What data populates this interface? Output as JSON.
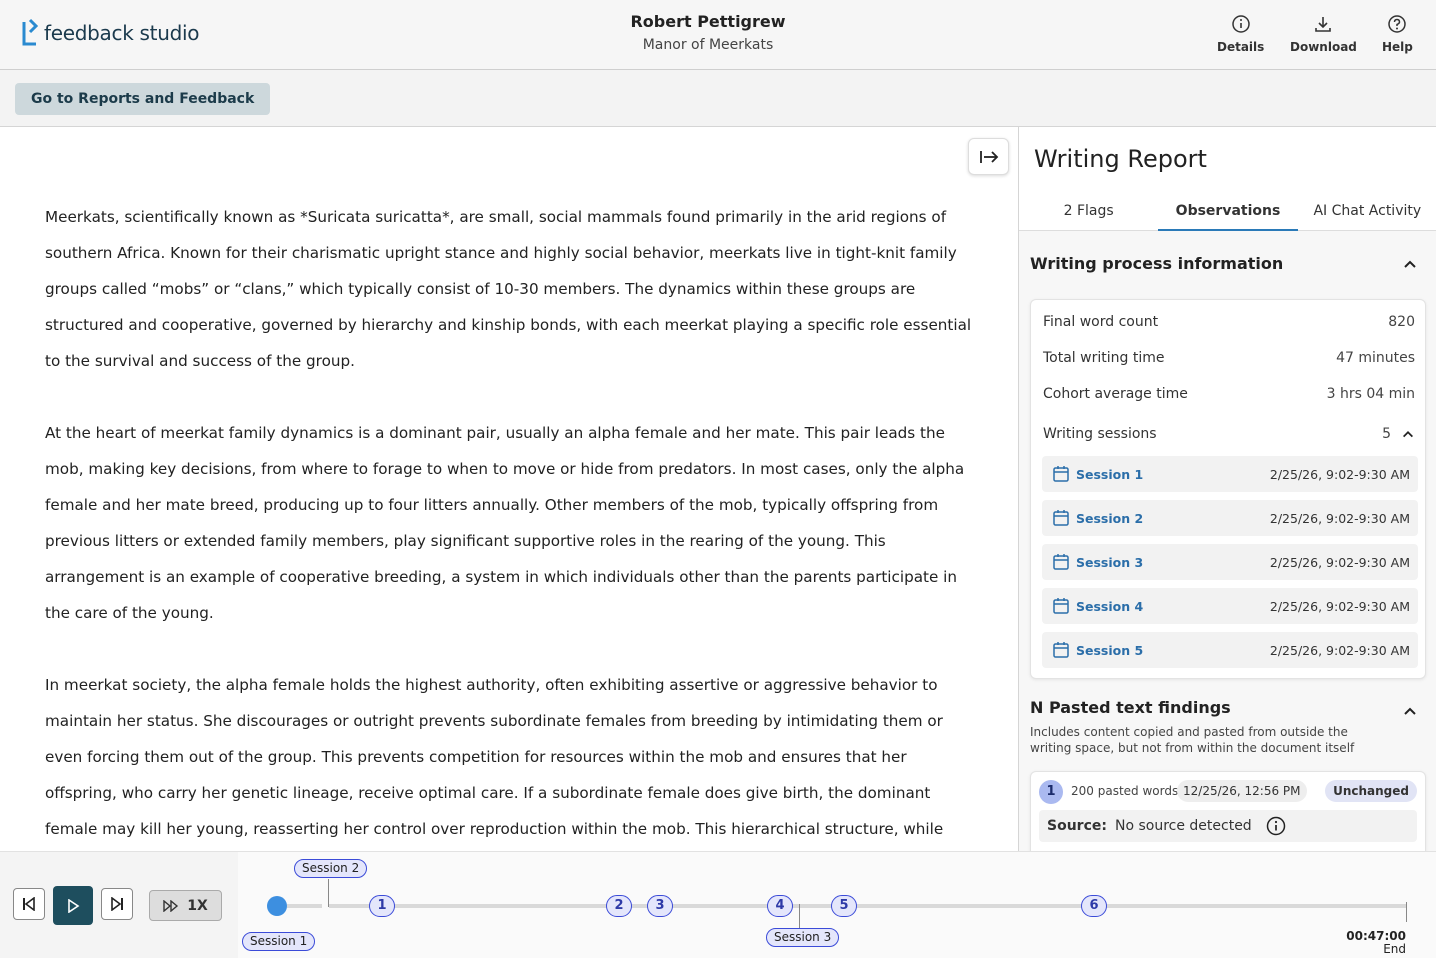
{
  "app": {
    "logo_text": "feedback studio"
  },
  "header": {
    "student_name": "Robert Pettigrew",
    "assignment_title": "Manor of Meerkats",
    "buttons": {
      "details": "Details",
      "download": "Download",
      "help": "Help"
    }
  },
  "subbar": {
    "back_label": "Go to Reports and Feedback"
  },
  "document": {
    "paragraphs": [
      "Meerkats, scientifically known as *Suricata suricatta*, are small, social mammals found primarily in the arid regions of southern Africa. Known for their charismatic upright stance and highly social behavior, meerkats live in tight-knit family groups called “mobs” or “clans,” which typically consist of 10-30 members. The dynamics within these groups are structured and cooperative, governed by hierarchy and kinship bonds, with each meerkat playing a specific role essential to the survival and success of the group.",
      "At the heart of meerkat family dynamics is a dominant pair, usually an alpha female and her mate. This pair leads the mob, making key decisions, from where to forage to when to move or hide from predators. In most cases, only the alpha female and her mate breed, producing up to four litters annually. Other members of the mob, typically offspring from previous litters or extended family members, play significant supportive roles in the rearing of the young. This arrangement is an example of cooperative breeding, a system in which individuals other than the parents participate in the care of the young.",
      "In meerkat society, the alpha female holds the highest authority, often exhibiting assertive or aggressive behavior to maintain her status. She discourages or outright prevents subordinate females from breeding by intimidating them or even forcing them out of the group. This prevents competition for resources within the mob and ensures that her offspring, who carry her genetic lineage, receive optimal care. If a subordinate female does give birth, the dominant female may kill her young, reasserting her control over reproduction within the mob. This hierarchical structure, while seemingly harsh, increases the likelihood that the dominant pair’s offspring will survive, helping to stabilize the group."
    ]
  },
  "panel": {
    "title": "Writing Report",
    "tabs": [
      "2 Flags",
      "Observations",
      "AI Chat Activity"
    ],
    "active_tab": "Observations",
    "writing_process": {
      "heading": "Writing process information",
      "rows": [
        {
          "label": "Final word count",
          "value": "820"
        },
        {
          "label": "Total writing time",
          "value": "47 minutes"
        },
        {
          "label": "Cohort average time",
          "value": "3 hrs 04 min"
        }
      ],
      "sessions_label": "Writing sessions",
      "sessions_count": "5",
      "sessions": [
        {
          "name": "Session 1",
          "date": "2/25/26, 9:02-9:30 AM"
        },
        {
          "name": "Session 2",
          "date": "2/25/26, 9:02-9:30 AM"
        },
        {
          "name": "Session 3",
          "date": "2/25/26, 9:02-9:30 AM"
        },
        {
          "name": "Session 4",
          "date": "2/25/26, 9:02-9:30 AM"
        },
        {
          "name": "Session 5",
          "date": "2/25/26, 9:02-9:30 AM"
        }
      ]
    },
    "pasted": {
      "heading": "N Pasted text findings",
      "description": "Includes content copied and pasted from outside the writing space, but not from within the document itself",
      "items": [
        {
          "number": "1",
          "words": "200 pasted words",
          "date": "12/25/26, 12:56 PM",
          "status": "Unchanged",
          "source_label": "Source:",
          "source_value": "No source detected"
        }
      ]
    }
  },
  "playback": {
    "speed": "1X",
    "markers": [
      "1",
      "2",
      "3",
      "4",
      "5",
      "6"
    ],
    "session_tags": [
      "Session 1",
      "Session 2",
      "Session 3"
    ],
    "end_time": "00:47:00",
    "end_label": "End"
  }
}
